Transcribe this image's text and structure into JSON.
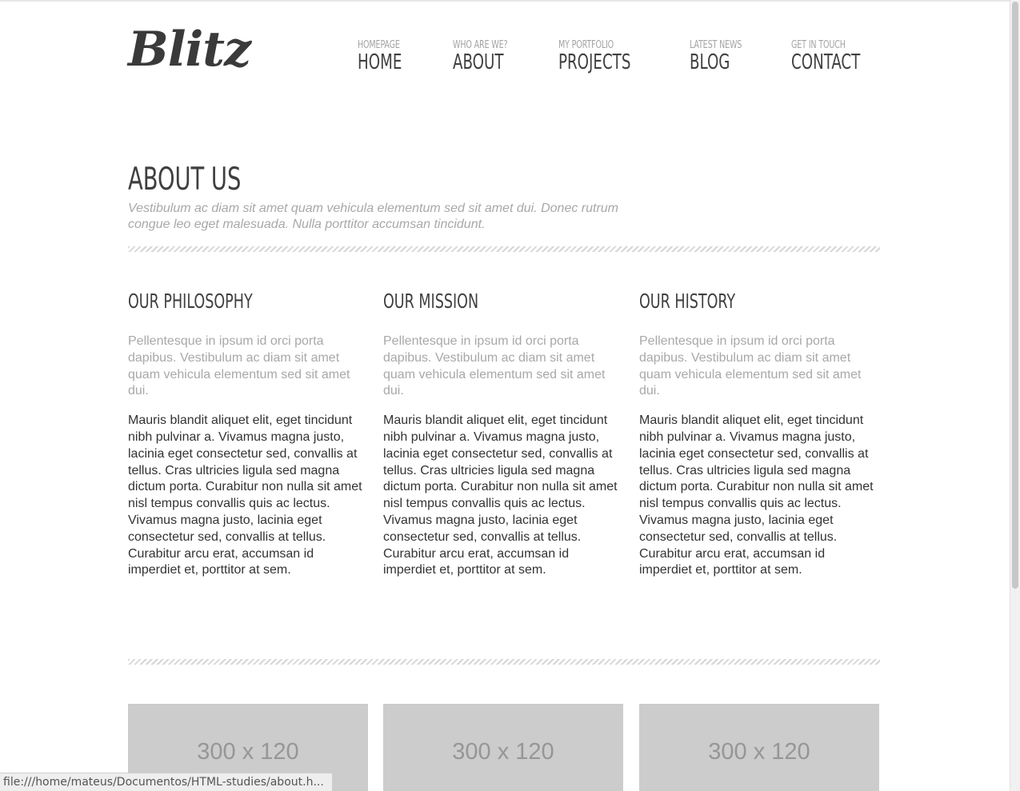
{
  "header": {
    "logo_text": "Blitz",
    "nav": [
      {
        "sub": "HOMEPAGE",
        "label": "HOME"
      },
      {
        "sub": "WHO ARE WE?",
        "label": "ABOUT"
      },
      {
        "sub": "MY PORTFOLIO",
        "label": "PROJECTS"
      },
      {
        "sub": "LATEST NEWS",
        "label": "BLOG"
      },
      {
        "sub": "GET IN TOUCH",
        "label": "CONTACT"
      }
    ]
  },
  "about": {
    "title": "ABOUT US",
    "lead": "Vestibulum ac diam sit amet quam vehicula elementum sed sit amet dui. Donec rutrum congue leo eget malesuada. Nulla porttitor accumsan tincidunt."
  },
  "columns": [
    {
      "title": "OUR PHILOSOPHY",
      "intro": "Pellentesque in ipsum id orci porta dapibus. Vestibulum ac diam sit amet quam vehicula elementum sed sit amet dui.",
      "body": "Mauris blandit aliquet elit, eget tincidunt nibh pulvinar a. Vivamus magna justo, lacinia eget consectetur sed, convallis at tellus. Cras ultricies ligula sed magna dictum porta. Curabitur non nulla sit amet nisl tempus convallis quis ac lectus. Vivamus magna justo, lacinia eget consectetur sed, convallis at tellus. Curabitur arcu erat, accumsan id imperdiet et, porttitor at sem."
    },
    {
      "title": "OUR MISSION",
      "intro": "Pellentesque in ipsum id orci porta dapibus. Vestibulum ac diam sit amet quam vehicula elementum sed sit amet dui.",
      "body": "Mauris blandit aliquet elit, eget tincidunt nibh pulvinar a. Vivamus magna justo, lacinia eget consectetur sed, convallis at tellus. Cras ultricies ligula sed magna dictum porta. Curabitur non nulla sit amet nisl tempus convallis quis ac lectus. Vivamus magna justo, lacinia eget consectetur sed, convallis at tellus. Curabitur arcu erat, accumsan id imperdiet et, porttitor at sem."
    },
    {
      "title": "OUR HISTORY",
      "intro": "Pellentesque in ipsum id orci porta dapibus. Vestibulum ac diam sit amet quam vehicula elementum sed sit amet dui.",
      "body": "Mauris blandit aliquet elit, eget tincidunt nibh pulvinar a. Vivamus magna justo, lacinia eget consectetur sed, convallis at tellus. Cras ultricies ligula sed magna dictum porta. Curabitur non nulla sit amet nisl tempus convallis quis ac lectus. Vivamus magna justo, lacinia eget consectetur sed, convallis at tellus. Curabitur arcu erat, accumsan id imperdiet et, porttitor at sem."
    }
  ],
  "thumbnails": [
    {
      "label": "300 x 120"
    },
    {
      "label": "300 x 120"
    },
    {
      "label": "300 x 120"
    }
  ],
  "browser": {
    "status_url": "file:///home/mateus/Documentos/HTML-studies/about.h..."
  },
  "colors": {
    "text_dark": "#3f3f3f",
    "text_muted": "#a8a8a8",
    "placeholder_bg": "#cccccc"
  }
}
